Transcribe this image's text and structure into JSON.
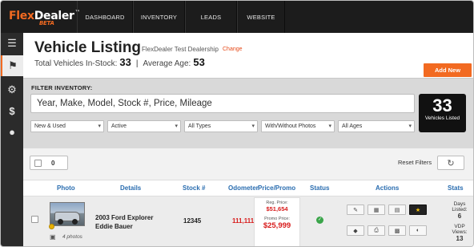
{
  "brand": {
    "name_part1": "Flex",
    "name_part2": "Dealer",
    "tm": "™",
    "beta": "BETA"
  },
  "nav": [
    {
      "label": "DASHBOARD"
    },
    {
      "label": "INVENTORY"
    },
    {
      "label": "LEADS"
    },
    {
      "label": "WEBSITE"
    }
  ],
  "header": {
    "title": "Vehicle Listing",
    "dealership": "FlexDealer Test Dealership",
    "change_link": "Change",
    "total_label": "Total Vehicles In-Stock:",
    "total_value": "33",
    "separator": "|",
    "avg_age_label": "Average Age:",
    "avg_age_value": "53",
    "add_new": "Add New"
  },
  "filter": {
    "label": "FILTER INVENTORY:",
    "search_placeholder": "Year, Make, Model, Stock #, Price, Mileage",
    "selects": [
      "New & Used",
      "Active",
      "All Types",
      "With/Without Photos",
      "All Ages"
    ],
    "count": "33",
    "count_label": "Vehicles Listed"
  },
  "toolbar": {
    "selected_count": "0",
    "reset_label": "Reset Filters"
  },
  "columns": [
    "Photo",
    "Details",
    "Stock #",
    "Odometer",
    "Price/Promo",
    "Status",
    "Actions",
    "Stats"
  ],
  "rows": [
    {
      "photo_count": "4 photos",
      "details_line1": "2003 Ford Explorer",
      "details_line2": "Eddie Bauer",
      "stock": "12345",
      "odometer": "111,111",
      "reg_price_label": "Reg. Price:",
      "reg_price": "$51,654",
      "promo_price_label": "Promo Price:",
      "promo_price": "$25,999",
      "days_listed_label": "Days Listed:",
      "days_listed": "6",
      "vdp_label": "VDP Views:",
      "vdp_views": "13"
    }
  ],
  "colors": {
    "accent": "#f26a21",
    "nav_bg": "#1c1c1c",
    "link_blue": "#2a6db0",
    "price_red": "#d81b1b"
  }
}
